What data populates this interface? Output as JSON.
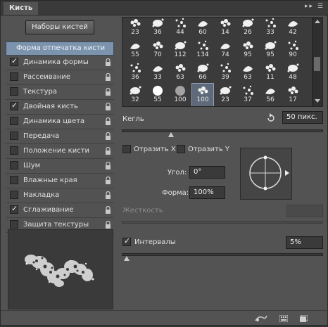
{
  "panel": {
    "tab_title": "Кисть"
  },
  "preset_button": "Наборы кистей",
  "options": {
    "header": "Форма отпечатка кисти",
    "items": [
      {
        "label": "Динамика формы",
        "checked": true
      },
      {
        "label": "Рассеивание",
        "checked": false
      },
      {
        "label": "Текстура",
        "checked": false
      },
      {
        "label": "Двойная кисть",
        "checked": true
      },
      {
        "label": "Динамика цвета",
        "checked": false
      },
      {
        "label": "Передача",
        "checked": false
      },
      {
        "label": "Положение кисти",
        "checked": false
      },
      {
        "label": "Шум",
        "checked": false
      },
      {
        "label": "Влажные края",
        "checked": false
      },
      {
        "label": "Накладка",
        "checked": false
      },
      {
        "label": "Сглаживание",
        "checked": true
      },
      {
        "label": "Защита текстуры",
        "checked": false
      }
    ]
  },
  "brushes": {
    "rows": [
      [
        "23",
        "36",
        "44",
        "60",
        "14",
        "26",
        "33",
        "42"
      ],
      [
        "55",
        "70",
        "112",
        "134",
        "74",
        "95",
        "95",
        "90"
      ],
      [
        "36",
        "33",
        "63",
        "66",
        "39",
        "63",
        "11",
        "48"
      ],
      [
        "32",
        "55",
        "100",
        "100",
        "23",
        "37",
        "56",
        "17"
      ]
    ],
    "selected": {
      "row": 3,
      "col": 3
    }
  },
  "size": {
    "label": "Кегль",
    "value": "50 пикс."
  },
  "flip_x": {
    "label": "Отразить X"
  },
  "flip_y": {
    "label": "Отразить Y"
  },
  "angle": {
    "label": "Угол:",
    "value": "0°"
  },
  "roundness": {
    "label": "Форма:",
    "value": "100%"
  },
  "hardness": {
    "label": "Жесткость"
  },
  "spacing": {
    "label": "Интервалы",
    "value": "5%",
    "checked": true
  },
  "colors": {
    "accent": "#7b93ad",
    "panel": "#535353",
    "field": "#3a3a3a"
  }
}
